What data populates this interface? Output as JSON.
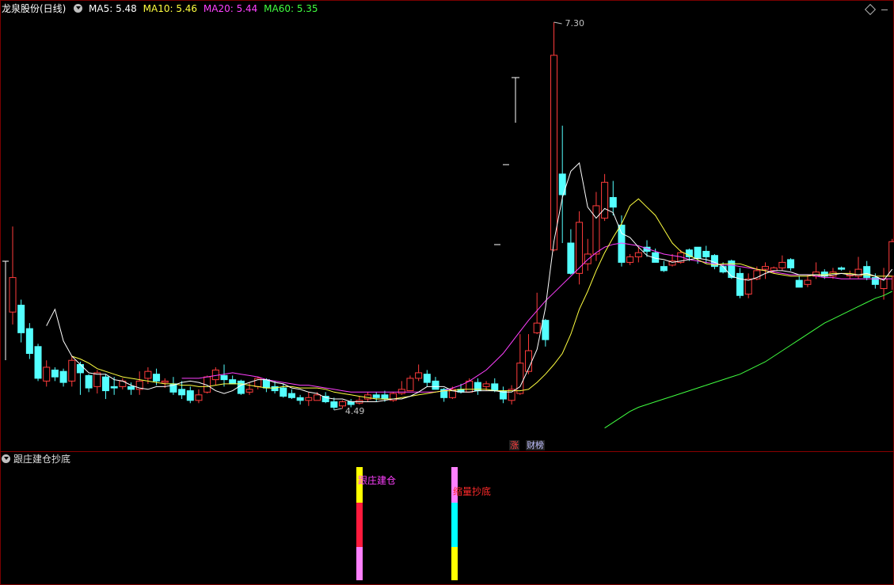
{
  "header": {
    "title": "龙泉股份(日线)",
    "ma5": "MA5: 5.48",
    "ma10": "MA10: 5.46",
    "ma20": "MA20: 5.44",
    "ma60": "MA60: 5.35"
  },
  "indicator": {
    "title": "跟庄建仓抄底",
    "signal1_label": "跟庄建仓",
    "signal2_label": "缩量抄底"
  },
  "badges": {
    "zhang": "涨",
    "cai": "财榜"
  },
  "colors": {
    "up": "#ff3c3c",
    "down": "#54ffff",
    "ma5": "#ffffff",
    "ma10": "#ffff40",
    "ma20": "#ff40ff",
    "ma60": "#40ff40"
  },
  "chart_data": {
    "type": "candlestick",
    "annotations": {
      "high_label": "7.30",
      "low_label": "4.49"
    },
    "candles": [
      [
        5.2,
        5.45,
        5.11,
        5.82
      ],
      [
        5.25,
        5.05,
        4.98,
        5.29
      ],
      [
        5.08,
        4.9,
        4.86,
        5.12
      ],
      [
        4.95,
        4.72,
        4.7,
        4.97
      ],
      [
        4.7,
        4.8,
        4.66,
        4.85
      ],
      [
        4.78,
        4.73,
        4.7,
        4.8
      ],
      [
        4.77,
        4.69,
        4.66,
        4.79
      ],
      [
        4.7,
        4.85,
        4.66,
        4.88
      ],
      [
        4.82,
        4.76,
        4.6,
        4.84
      ],
      [
        4.74,
        4.65,
        4.62,
        4.75
      ],
      [
        4.66,
        4.76,
        4.61,
        4.78
      ],
      [
        4.73,
        4.63,
        4.57,
        4.75
      ],
      [
        4.66,
        4.65,
        4.6,
        4.73
      ],
      [
        4.66,
        4.7,
        4.64,
        4.72
      ],
      [
        4.66,
        4.64,
        4.6,
        4.69
      ],
      [
        4.64,
        4.7,
        4.6,
        4.77
      ],
      [
        4.72,
        4.77,
        4.68,
        4.8
      ],
      [
        4.75,
        4.7,
        4.67,
        4.79
      ],
      [
        4.69,
        4.7,
        4.65,
        4.72
      ],
      [
        4.68,
        4.62,
        4.6,
        4.73
      ],
      [
        4.64,
        4.6,
        4.57,
        4.7
      ],
      [
        4.63,
        4.56,
        4.54,
        4.66
      ],
      [
        4.56,
        4.6,
        4.54,
        4.64
      ],
      [
        4.62,
        4.73,
        4.61,
        4.74
      ],
      [
        4.71,
        4.78,
        4.67,
        4.8
      ],
      [
        4.74,
        4.71,
        4.66,
        4.82
      ],
      [
        4.71,
        4.68,
        4.68,
        4.74
      ],
      [
        4.7,
        4.61,
        4.6,
        4.71
      ],
      [
        4.62,
        4.64,
        4.6,
        4.69
      ],
      [
        4.66,
        4.72,
        4.64,
        4.73
      ],
      [
        4.71,
        4.65,
        4.62,
        4.72
      ],
      [
        4.66,
        4.63,
        4.61,
        4.7
      ],
      [
        4.65,
        4.59,
        4.58,
        4.68
      ],
      [
        4.61,
        4.58,
        4.57,
        4.64
      ],
      [
        4.58,
        4.56,
        4.53,
        4.6
      ],
      [
        4.56,
        4.58,
        4.52,
        4.62
      ],
      [
        4.56,
        4.6,
        4.56,
        4.62
      ],
      [
        4.59,
        4.55,
        4.54,
        4.62
      ],
      [
        4.55,
        4.51,
        4.49,
        4.58
      ],
      [
        4.52,
        4.55,
        4.5,
        4.56
      ],
      [
        4.55,
        4.53,
        4.51,
        4.57
      ],
      [
        4.54,
        4.56,
        4.53,
        4.59
      ],
      [
        4.57,
        4.6,
        4.55,
        4.62
      ],
      [
        4.6,
        4.58,
        4.55,
        4.62
      ],
      [
        4.6,
        4.57,
        4.55,
        4.63
      ],
      [
        4.56,
        4.61,
        4.55,
        4.62
      ],
      [
        4.61,
        4.64,
        4.6,
        4.7
      ],
      [
        4.63,
        4.72,
        4.63,
        4.74
      ],
      [
        4.72,
        4.76,
        4.7,
        4.82
      ],
      [
        4.75,
        4.69,
        4.66,
        4.78
      ],
      [
        4.7,
        4.64,
        4.64,
        4.73
      ],
      [
        4.64,
        4.58,
        4.55,
        4.65
      ],
      [
        4.58,
        4.64,
        4.57,
        4.66
      ],
      [
        4.64,
        4.62,
        4.61,
        4.68
      ],
      [
        4.62,
        4.7,
        4.62,
        4.72
      ],
      [
        4.69,
        4.63,
        4.6,
        4.72
      ],
      [
        4.66,
        4.68,
        4.63,
        4.7
      ],
      [
        4.68,
        4.63,
        4.62,
        4.72
      ],
      [
        4.63,
        4.57,
        4.54,
        4.66
      ],
      [
        4.56,
        4.64,
        4.53,
        4.67
      ],
      [
        4.61,
        4.83,
        4.6,
        5.04
      ],
      [
        4.77,
        4.92,
        4.75,
        5.04
      ],
      [
        5.05,
        5.12,
        5.04,
        5.34
      ],
      [
        5.14,
        5.0,
        4.95,
        5.15
      ],
      [
        5.65,
        7.06,
        5.64,
        7.3
      ],
      [
        6.2,
        6.05,
        5.7,
        6.55
      ],
      [
        5.7,
        5.48,
        5.47,
        5.8
      ],
      [
        5.48,
        5.85,
        5.4,
        5.93
      ],
      [
        5.55,
        5.62,
        5.5,
        5.73
      ],
      [
        5.62,
        5.97,
        5.57,
        6.07
      ],
      [
        5.88,
        6.14,
        5.86,
        6.2
      ],
      [
        6.03,
        5.96,
        5.9,
        6.15
      ],
      [
        5.83,
        5.56,
        5.53,
        5.9
      ],
      [
        5.56,
        5.6,
        5.54,
        5.62
      ],
      [
        5.6,
        5.63,
        5.56,
        5.67
      ],
      [
        5.67,
        5.64,
        5.6,
        5.72
      ],
      [
        5.63,
        5.56,
        5.56,
        5.66
      ],
      [
        5.53,
        5.5,
        5.49,
        5.57
      ],
      [
        5.54,
        5.57,
        5.53,
        5.62
      ],
      [
        5.56,
        5.63,
        5.55,
        5.65
      ],
      [
        5.65,
        5.6,
        5.57,
        5.66
      ],
      [
        5.67,
        5.59,
        5.55,
        5.67
      ],
      [
        5.64,
        5.6,
        5.55,
        5.68
      ],
      [
        5.61,
        5.53,
        5.51,
        5.62
      ],
      [
        5.53,
        5.49,
        5.48,
        5.56
      ],
      [
        5.57,
        5.45,
        5.44,
        5.58
      ],
      [
        5.48,
        5.32,
        5.3,
        5.52
      ],
      [
        5.33,
        5.44,
        5.3,
        5.48
      ],
      [
        5.44,
        5.5,
        5.43,
        5.53
      ],
      [
        5.51,
        5.53,
        5.44,
        5.56
      ],
      [
        5.5,
        5.52,
        5.48,
        5.53
      ],
      [
        5.52,
        5.56,
        5.5,
        5.61
      ],
      [
        5.58,
        5.52,
        5.5,
        5.59
      ],
      [
        5.43,
        5.38,
        5.38,
        5.46
      ],
      [
        5.4,
        5.43,
        5.38,
        5.47
      ],
      [
        5.46,
        5.49,
        5.44,
        5.56
      ],
      [
        5.49,
        5.46,
        5.44,
        5.51
      ],
      [
        5.46,
        5.49,
        5.44,
        5.52
      ],
      [
        5.52,
        5.51,
        5.5,
        5.53
      ],
      [
        5.47,
        5.47,
        5.44,
        5.5
      ],
      [
        5.46,
        5.51,
        5.44,
        5.6
      ],
      [
        5.53,
        5.45,
        5.43,
        5.57
      ],
      [
        5.45,
        5.4,
        5.37,
        5.48
      ],
      [
        5.37,
        5.44,
        5.29,
        5.52
      ],
      [
        5.46,
        5.71,
        5.36,
        5.73
      ]
    ],
    "ma5": [
      5.1,
      5.22,
      4.99,
      4.88,
      4.82,
      4.76,
      4.75,
      4.75,
      4.71,
      4.7,
      4.67,
      4.65,
      4.64,
      4.66,
      4.66,
      4.67,
      4.69,
      4.7,
      4.69,
      4.67,
      4.63,
      4.61,
      4.63,
      4.67,
      4.69,
      4.71,
      4.71,
      4.69,
      4.68,
      4.65,
      4.64,
      4.62,
      4.61,
      4.58,
      4.57,
      4.57,
      4.55,
      4.55,
      4.55,
      4.55,
      4.56,
      4.57,
      4.57,
      4.59,
      4.62,
      4.66,
      4.66,
      4.66,
      4.63,
      4.62,
      4.62,
      4.63,
      4.63,
      4.63,
      4.62,
      4.62,
      4.66,
      4.79,
      4.93,
      5.23,
      5.71,
      6.03,
      6.22,
      6.28,
      5.96,
      5.88,
      5.95,
      5.92,
      5.77,
      5.74,
      5.67,
      5.61,
      5.59,
      5.58,
      5.56,
      5.57,
      5.58,
      5.59,
      5.58,
      5.56,
      5.53,
      5.46,
      5.44,
      5.43,
      5.45,
      5.48,
      5.5,
      5.5,
      5.49,
      5.47,
      5.47,
      5.47,
      5.46,
      5.47,
      5.48,
      5.47,
      5.47,
      5.48,
      5.46,
      5.43,
      5.51
    ],
    "ma10": [
      4.88,
      4.86,
      4.83,
      4.79,
      4.77,
      4.75,
      4.73,
      4.72,
      4.71,
      4.7,
      4.69,
      4.68,
      4.68,
      4.67,
      4.67,
      4.66,
      4.66,
      4.67,
      4.68,
      4.68,
      4.68,
      4.67,
      4.66,
      4.65,
      4.65,
      4.66,
      4.66,
      4.65,
      4.65,
      4.65,
      4.64,
      4.62,
      4.61,
      4.6,
      4.59,
      4.58,
      4.57,
      4.57,
      4.57,
      4.58,
      4.59,
      4.6,
      4.61,
      4.62,
      4.63,
      4.63,
      4.64,
      4.64,
      4.64,
      4.64,
      4.63,
      4.63,
      4.63,
      4.63,
      4.64,
      4.69,
      4.75,
      4.82,
      4.9,
      5.04,
      5.22,
      5.35,
      5.5,
      5.63,
      5.74,
      5.84,
      5.97,
      6.02,
      5.96,
      5.9,
      5.8,
      5.7,
      5.64,
      5.61,
      5.58,
      5.55,
      5.54,
      5.55,
      5.55,
      5.55,
      5.53,
      5.51,
      5.5,
      5.48,
      5.47,
      5.46,
      5.46,
      5.46,
      5.47,
      5.47,
      5.48,
      5.48,
      5.48,
      5.47,
      5.47,
      5.46,
      5.46,
      5.46
    ],
    "ma20": [
      4.72,
      4.72,
      4.72,
      4.73,
      4.74,
      4.75,
      4.76,
      4.75,
      4.74,
      4.73,
      4.71,
      4.7,
      4.69,
      4.68,
      4.67,
      4.67,
      4.66,
      4.65,
      4.64,
      4.63,
      4.62,
      4.62,
      4.62,
      4.62,
      4.62,
      4.62,
      4.62,
      4.62,
      4.62,
      4.62,
      4.62,
      4.63,
      4.65,
      4.67,
      4.7,
      4.74,
      4.78,
      4.84,
      4.9,
      4.98,
      5.06,
      5.14,
      5.21,
      5.28,
      5.34,
      5.4,
      5.46,
      5.52,
      5.58,
      5.63,
      5.67,
      5.69,
      5.7,
      5.69,
      5.68,
      5.66,
      5.64,
      5.62,
      5.61,
      5.6,
      5.58,
      5.57,
      5.56,
      5.55,
      5.54,
      5.54,
      5.53,
      5.52,
      5.51,
      5.5,
      5.49,
      5.48,
      5.47,
      5.47,
      5.47,
      5.46,
      5.45,
      5.45,
      5.44,
      5.44,
      5.44,
      5.44,
      5.44,
      5.44,
      5.44
    ],
    "ma60": [
      4.36,
      4.4,
      4.44,
      4.48,
      4.51,
      4.53,
      4.55,
      4.57,
      4.59,
      4.61,
      4.63,
      4.65,
      4.67,
      4.69,
      4.71,
      4.73,
      4.75,
      4.78,
      4.81,
      4.84,
      4.88,
      4.92,
      4.96,
      5.0,
      5.04,
      5.08,
      5.12,
      5.15,
      5.18,
      5.21,
      5.24,
      5.27,
      5.3,
      5.32,
      5.35
    ]
  }
}
